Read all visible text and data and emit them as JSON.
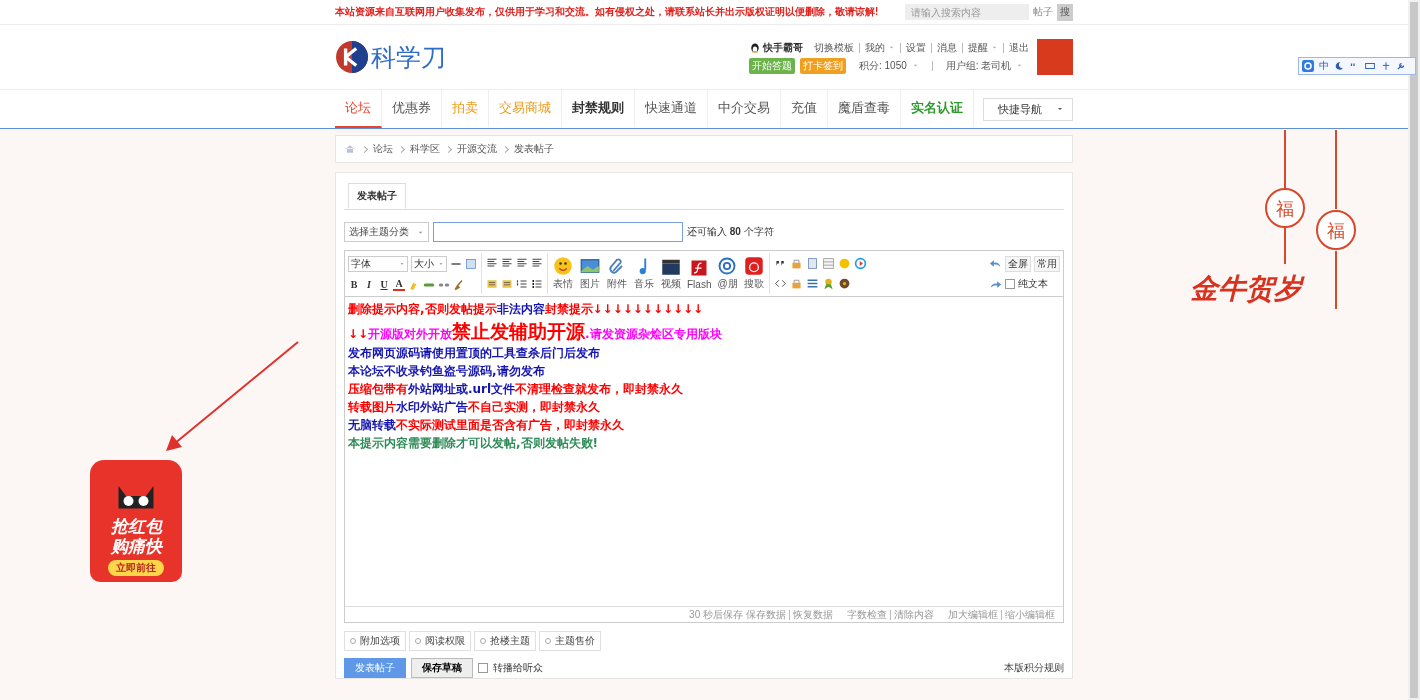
{
  "notice": "本站资源来自互联网用户收集发布，仅供用于学习和交流。如有侵权之处，请联系站长并出示版权证明以便删除，敬请谅解!",
  "top_search": {
    "placeholder": "请输入搜索内容",
    "scope": "帖子",
    "button": "搜"
  },
  "logo": {
    "text": "科学刀"
  },
  "user": {
    "name": "快手霸哥",
    "links": [
      {
        "label": "切换模板",
        "dropdown": false
      },
      {
        "label": "我的",
        "dropdown": true
      },
      {
        "label": "设置",
        "dropdown": false
      },
      {
        "label": "消息",
        "dropdown": false
      },
      {
        "label": "提醒",
        "dropdown": true
      },
      {
        "label": "退出",
        "dropdown": false
      }
    ],
    "badges": [
      {
        "label": "开始答题",
        "color": "#6bb34a"
      },
      {
        "label": "打卡签到",
        "color": "#f0a020"
      }
    ],
    "points": "积分: 1050",
    "group": "用户组: 老司机"
  },
  "nav": {
    "items": [
      {
        "label": "论坛",
        "color": "#e8432b",
        "bold": false,
        "selected": true
      },
      {
        "label": "优惠券",
        "color": "#555555",
        "bold": false,
        "selected": false
      },
      {
        "label": "拍卖",
        "color": "#f09a1a",
        "bold": false,
        "selected": false
      },
      {
        "label": "交易商城",
        "color": "#f09a1a",
        "bold": false,
        "selected": false
      },
      {
        "label": "封禁规则",
        "color": "#333333",
        "bold": true,
        "selected": false
      },
      {
        "label": "快速通道",
        "color": "#555555",
        "bold": false,
        "selected": false
      },
      {
        "label": "中介交易",
        "color": "#555555",
        "bold": false,
        "selected": false
      },
      {
        "label": "充值",
        "color": "#555555",
        "bold": false,
        "selected": false
      },
      {
        "label": "魔盾查毒",
        "color": "#555555",
        "bold": false,
        "selected": false
      },
      {
        "label": "实名认证",
        "color": "#2a9a2a",
        "bold": true,
        "selected": false
      }
    ],
    "quick_nav": "快捷导航"
  },
  "breadcrumb": [
    "论坛",
    "科学区",
    "开源交流",
    "发表帖子"
  ],
  "post": {
    "tab": "发表帖子",
    "category": "选择主题分类",
    "remaining": "还可输入 **80** 个字符",
    "toolbar": {
      "font": "字体",
      "size": "大小",
      "format": [
        "B",
        "I",
        "U",
        "A"
      ],
      "media": [
        "表情",
        "图片",
        "附件",
        "音乐",
        "视频",
        "Flash",
        "@朋",
        "搜歌"
      ],
      "fullscreen": "全屏",
      "common": "常用",
      "plain_text": {
        "label": "纯文本",
        "checked": false
      }
    },
    "content": [
      [
        {
          "text": "删除提示内容,否则发帖提示",
          "color": "#ff0000",
          "kind": "normal"
        },
        {
          "text": "非法内容",
          "color": "#1515b0",
          "kind": "normal"
        },
        {
          "text": "封禁提示↓↓↓↓↓↓↓↓↓↓↓",
          "color": "#ff0000",
          "kind": "normal"
        }
      ],
      [
        {
          "text": "↓↓",
          "color": "#ff0000",
          "kind": "normal"
        },
        {
          "text": "开源版对外开放",
          "color": "#ff00ff",
          "kind": "normal"
        },
        {
          "text": "禁止发辅助开源",
          "color": "#ff0000",
          "kind": "large"
        },
        {
          "text": ".请发资源杂烩区专用版块",
          "color": "#ff00ff",
          "kind": "normal"
        }
      ],
      [
        {
          "text": "发布网页源码请使用置顶的工具查杀后门后发布",
          "color": "#1515b0",
          "kind": "normal"
        }
      ],
      [
        {
          "text": "本论坛不收录钓鱼盗号源码,请勿发布",
          "color": "#1515b0",
          "kind": "normal"
        }
      ],
      [
        {
          "text": "压缩包带有",
          "color": "#ff0000",
          "kind": "normal"
        },
        {
          "text": "外站网址或.url文件",
          "color": "#1515b0",
          "kind": "normal"
        },
        {
          "text": "不清理检查就发布，即封禁永久",
          "color": "#ff0000",
          "kind": "normal"
        }
      ],
      [
        {
          "text": "转载图片",
          "color": "#ff0000",
          "kind": "normal"
        },
        {
          "text": "水印外站广告",
          "color": "#1515b0",
          "kind": "normal"
        },
        {
          "text": "不自己实测，即封禁永久",
          "color": "#ff0000",
          "kind": "normal"
        }
      ],
      [
        {
          "text": "无脑转载",
          "color": "#1515b0",
          "kind": "normal"
        },
        {
          "text": "不实际测试",
          "color": "#ff0000",
          "kind": "normal"
        },
        {
          "text": "里面是否含有广告，即封禁永久",
          "color": "#ff0000",
          "kind": "normal"
        }
      ],
      [
        {
          "text": "本提示内容需要删除才可以发帖,否则发帖失败!",
          "color": "#2e8b57",
          "kind": "normal"
        }
      ]
    ],
    "status": {
      "autosave": "30 秒后保存",
      "links": [
        "保存数据",
        "恢复数据",
        "字数检查",
        "清除内容",
        "加大编辑框",
        "缩小编辑框"
      ]
    },
    "options": [
      "附加选项",
      "阅读权限",
      "抢楼主题",
      "主题售价"
    ],
    "submit": "发表帖子",
    "draft": "保存草稿",
    "broadcast": {
      "label": "转播给听众",
      "checked": false
    },
    "rules": "本版积分规则"
  },
  "ad": {
    "lines": [
      "抢红包",
      "购痛快"
    ],
    "button": "立即前往"
  },
  "decoration": {
    "charms": [
      "福",
      "福"
    ],
    "slogan": "金牛贺岁"
  },
  "ime": {
    "mode": "中"
  }
}
